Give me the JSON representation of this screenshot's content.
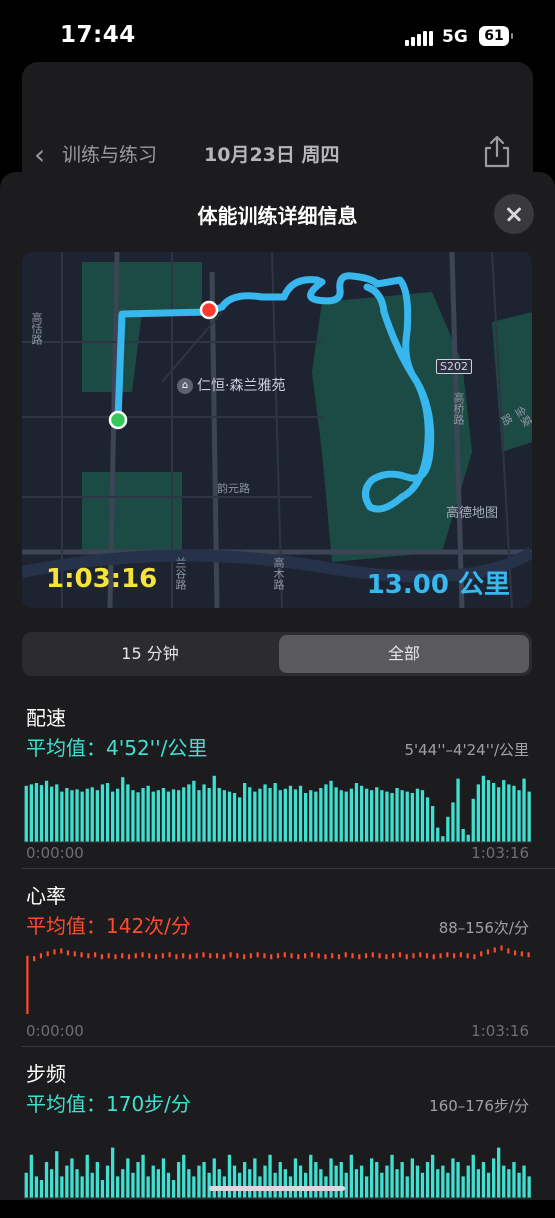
{
  "status": {
    "time": "17:44",
    "network": "5G",
    "battery": "61"
  },
  "background_nav": {
    "back_label": "训练与练习",
    "date": "10月23日 周四"
  },
  "sheet": {
    "title": "体能训练详细信息"
  },
  "map": {
    "duration": "1:03:16",
    "distance": "13.00 公里",
    "poi": "仁恒·森兰雅苑",
    "labels": [
      "兰谷路",
      "韵元路",
      "高木路",
      "高恬路",
      "高桥路",
      "金葵路",
      "S202",
      "高德地图"
    ],
    "route_color": "#38b7ee",
    "start_color": "#34c759",
    "end_color": "#ff3b30"
  },
  "segmented": {
    "options": [
      "15 分钟",
      "全部"
    ],
    "selected": "全部"
  },
  "metrics": [
    {
      "title": "配速",
      "average": "平均值：4'52''/公里",
      "range": "5'44''–4'24''/公里",
      "start": "0:00:00",
      "end": "1:03:16",
      "color": "#40e0d0",
      "type": "bar"
    },
    {
      "title": "心率",
      "average": "平均值：142次/分",
      "range": "88–156次/分",
      "start": "0:00:00",
      "end": "1:03:16",
      "color": "#ff4a2e",
      "type": "line-ticks"
    },
    {
      "title": "步频",
      "average": "平均值：170步/分",
      "range": "160–176步/分",
      "color": "#40e0d0",
      "type": "bar"
    }
  ],
  "chart_data": [
    {
      "type": "bar",
      "title": "配速",
      "xlabel": "",
      "ylabel": "",
      "x_range": [
        "0:00:00",
        "1:03:16"
      ],
      "series": [
        {
          "values": [
            0.78,
            0.8,
            0.82,
            0.79,
            0.85,
            0.77,
            0.8,
            0.7,
            0.75,
            0.72,
            0.73,
            0.7,
            0.74,
            0.76,
            0.72,
            0.8,
            0.82,
            0.7,
            0.74,
            0.9,
            0.8,
            0.72,
            0.69,
            0.75,
            0.78,
            0.7,
            0.72,
            0.75,
            0.7,
            0.73,
            0.72,
            0.76,
            0.8,
            0.85,
            0.72,
            0.8,
            0.75,
            0.92,
            0.75,
            0.72,
            0.7,
            0.68,
            0.62,
            0.82,
            0.76,
            0.7,
            0.74,
            0.8,
            0.75,
            0.82,
            0.72,
            0.74,
            0.78,
            0.73,
            0.78,
            0.68,
            0.72,
            0.7,
            0.75,
            0.8,
            0.85,
            0.76,
            0.72,
            0.7,
            0.74,
            0.82,
            0.78,
            0.74,
            0.72,
            0.76,
            0.72,
            0.7,
            0.68,
            0.75,
            0.72,
            0.7,
            0.68,
            0.74,
            0.72,
            0.62,
            0.5,
            0.2,
            0.08,
            0.35,
            0.55,
            0.88,
            0.18,
            0.1,
            0.6,
            0.8,
            0.92,
            0.86,
            0.82,
            0.76,
            0.86,
            0.8,
            0.78,
            0.72,
            0.88,
            0.7
          ]
        }
      ]
    },
    {
      "type": "line",
      "title": "心率",
      "x_range": [
        "0:00:00",
        "1:03:16"
      ],
      "ylim": [
        88,
        156
      ],
      "series": [
        {
          "values": [
            88,
            145,
            148,
            150,
            152,
            153,
            151,
            150,
            149,
            148,
            149,
            147,
            148,
            147,
            148,
            147,
            148,
            149,
            148,
            147,
            148,
            149,
            147,
            148,
            147,
            148,
            149,
            148,
            148,
            147,
            149,
            148,
            147,
            148,
            149,
            148,
            147,
            148,
            149,
            148,
            147,
            148,
            149,
            148,
            147,
            148,
            147,
            149,
            148,
            147,
            148,
            149,
            148,
            147,
            148,
            149,
            147,
            148,
            149,
            148,
            147,
            148,
            149,
            148,
            149,
            148,
            147,
            150,
            152,
            154,
            156,
            153,
            151,
            150,
            149
          ]
        }
      ]
    },
    {
      "type": "bar",
      "title": "步频",
      "series": [
        {
          "values": [
            0.35,
            0.6,
            0.3,
            0.25,
            0.5,
            0.4,
            0.65,
            0.3,
            0.45,
            0.55,
            0.4,
            0.3,
            0.6,
            0.35,
            0.5,
            0.25,
            0.45,
            0.7,
            0.3,
            0.4,
            0.55,
            0.35,
            0.5,
            0.6,
            0.3,
            0.45,
            0.4,
            0.55,
            0.35,
            0.25,
            0.5,
            0.6,
            0.4,
            0.3,
            0.45,
            0.5,
            0.35,
            0.55,
            0.4,
            0.3,
            0.6,
            0.45,
            0.35,
            0.5,
            0.4,
            0.55,
            0.3,
            0.45,
            0.6,
            0.35,
            0.5,
            0.4,
            0.3,
            0.55,
            0.45,
            0.35,
            0.6,
            0.5,
            0.4,
            0.3,
            0.55,
            0.45,
            0.5,
            0.35,
            0.6,
            0.4,
            0.45,
            0.3,
            0.55,
            0.5,
            0.35,
            0.45,
            0.6,
            0.4,
            0.5,
            0.3,
            0.55,
            0.45,
            0.35,
            0.5,
            0.6,
            0.4,
            0.45,
            0.35,
            0.55,
            0.5,
            0.3,
            0.45,
            0.6,
            0.4,
            0.5,
            0.35,
            0.55,
            0.7,
            0.45,
            0.4,
            0.5,
            0.35,
            0.45,
            0.3
          ]
        }
      ]
    }
  ]
}
